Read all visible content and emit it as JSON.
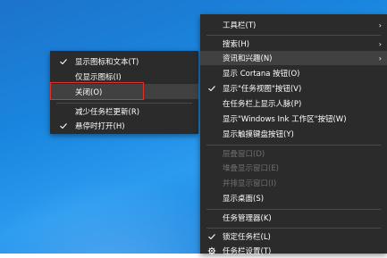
{
  "left_menu": {
    "items": [
      {
        "label": "显示图标和文本(T)",
        "checked": true,
        "disabled": false
      },
      {
        "label": "仅显示图标(I)",
        "checked": false,
        "disabled": false
      },
      {
        "label": "关闭(O)",
        "checked": false,
        "disabled": false
      },
      {
        "label": "减少任务栏更新(R)",
        "checked": false,
        "disabled": false
      },
      {
        "label": "悬停时打开(H)",
        "checked": true,
        "disabled": false
      }
    ]
  },
  "right_menu": {
    "items": [
      {
        "label": "工具栏(T)",
        "checked": false,
        "disabled": false
      },
      {
        "label": "搜索(H)",
        "checked": false,
        "disabled": false
      },
      {
        "label": "资讯和兴趣(N)",
        "checked": false,
        "disabled": false
      },
      {
        "label": "显示 Cortana 按钮(O)",
        "checked": false,
        "disabled": false
      },
      {
        "label": "显示\"任务视图\"按钮(V)",
        "checked": true,
        "disabled": false
      },
      {
        "label": "在任务栏上显示人脉(P)",
        "checked": false,
        "disabled": false
      },
      {
        "label": "显示\"Windows Ink 工作区\"按钮(W)",
        "checked": false,
        "disabled": false
      },
      {
        "label": "显示触摸键盘按钮(Y)",
        "checked": false,
        "disabled": false
      },
      {
        "label": "层叠窗口(D)",
        "checked": false,
        "disabled": true
      },
      {
        "label": "堆叠显示窗口(E)",
        "checked": false,
        "disabled": true
      },
      {
        "label": "并排显示窗口(I)",
        "checked": false,
        "disabled": true
      },
      {
        "label": "显示桌面(S)",
        "checked": false,
        "disabled": false
      },
      {
        "label": "任务管理器(K)",
        "checked": false,
        "disabled": false
      },
      {
        "label": "锁定任务栏(L)",
        "checked": true,
        "disabled": false
      },
      {
        "label": "任务栏设置(T)",
        "checked": false,
        "disabled": false
      }
    ]
  },
  "colors": {
    "menu_bg": "#2b2b2b",
    "hover_bg": "#414141",
    "highlight_border": "#e0302a",
    "disabled_text": "#6f6f6f"
  }
}
